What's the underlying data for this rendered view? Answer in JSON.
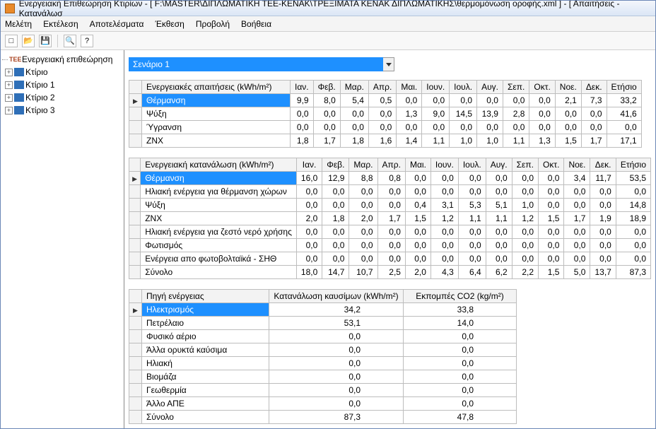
{
  "window_title": "Ενεργειακή Επιθεώρηση Κτιρίων - [ F:\\MASTER\\ΔΙΠΛΩΜΑΤΙΚΗ ΤΕΕ-ΚΕΝΑΚ\\ΤΡΕΞΙΜΑΤΑ ΚΕΝΑΚ ΔΙΠΛΩΜΑΤΙΚΗΣ\\θερμομόνωση οροφής.xml ] - [ Απαιτήσεις - Κατανάλωσ",
  "menu": [
    "Μελέτη",
    "Εκτέλεση",
    "Αποτελέσματα",
    "Έκθεση",
    "Προβολή",
    "Βοήθεια"
  ],
  "toolbar_icons": [
    "new-icon",
    "open-icon",
    "save-icon",
    "preview-icon",
    "help-icon"
  ],
  "tree": {
    "root": "Ενεργειακή επιθεώρηση",
    "children": [
      "Κτίριο",
      "Κτίριο 1",
      "Κτίριο 2",
      "Κτίριο 3"
    ]
  },
  "scenario": "Σενάριο 1",
  "months": [
    "Ιαν.",
    "Φεβ.",
    "Μαρ.",
    "Απρ.",
    "Μαι.",
    "Ιουν.",
    "Ιουλ.",
    "Αυγ.",
    "Σεπ.",
    "Οκτ.",
    "Νοε.",
    "Δεκ.",
    "Ετήσιο"
  ],
  "table1": {
    "title": "Ενεργειακές απαιτήσεις (kWh/m²)",
    "rows": [
      {
        "label": "Θέρμανση",
        "hl": true,
        "v": [
          "9,9",
          "8,0",
          "5,4",
          "0,5",
          "0,0",
          "0,0",
          "0,0",
          "0,0",
          "0,0",
          "0,0",
          "2,1",
          "7,3",
          "33,2"
        ]
      },
      {
        "label": "Ψύξη",
        "v": [
          "0,0",
          "0,0",
          "0,0",
          "0,0",
          "1,3",
          "9,0",
          "14,5",
          "13,9",
          "2,8",
          "0,0",
          "0,0",
          "0,0",
          "41,6"
        ]
      },
      {
        "label": "Ύγρανση",
        "v": [
          "0,0",
          "0,0",
          "0,0",
          "0,0",
          "0,0",
          "0,0",
          "0,0",
          "0,0",
          "0,0",
          "0,0",
          "0,0",
          "0,0",
          "0,0"
        ]
      },
      {
        "label": "ΖΝΧ",
        "v": [
          "1,8",
          "1,7",
          "1,8",
          "1,6",
          "1,4",
          "1,1",
          "1,0",
          "1,0",
          "1,1",
          "1,3",
          "1,5",
          "1,7",
          "17,1"
        ]
      }
    ]
  },
  "table2": {
    "title": "Ενεργειακή κατανάλωση (kWh/m²)",
    "rows": [
      {
        "label": "Θέρμανση",
        "hl": true,
        "v": [
          "16,0",
          "12,9",
          "8,8",
          "0,8",
          "0,0",
          "0,0",
          "0,0",
          "0,0",
          "0,0",
          "0,0",
          "3,4",
          "11,7",
          "53,5"
        ]
      },
      {
        "label": "Ηλιακή ενέργεια για θέρμανση χώρων",
        "v": [
          "0,0",
          "0,0",
          "0,0",
          "0,0",
          "0,0",
          "0,0",
          "0,0",
          "0,0",
          "0,0",
          "0,0",
          "0,0",
          "0,0",
          "0,0"
        ]
      },
      {
        "label": "Ψύξη",
        "v": [
          "0,0",
          "0,0",
          "0,0",
          "0,0",
          "0,4",
          "3,1",
          "5,3",
          "5,1",
          "1,0",
          "0,0",
          "0,0",
          "0,0",
          "14,8"
        ]
      },
      {
        "label": "ΖΝΧ",
        "v": [
          "2,0",
          "1,8",
          "2,0",
          "1,7",
          "1,5",
          "1,2",
          "1,1",
          "1,1",
          "1,2",
          "1,5",
          "1,7",
          "1,9",
          "18,9"
        ]
      },
      {
        "label": "Ηλιακή ενέργεια για ζεστό νερό χρήσης",
        "v": [
          "0,0",
          "0,0",
          "0,0",
          "0,0",
          "0,0",
          "0,0",
          "0,0",
          "0,0",
          "0,0",
          "0,0",
          "0,0",
          "0,0",
          "0,0"
        ]
      },
      {
        "label": "Φωτισμός",
        "v": [
          "0,0",
          "0,0",
          "0,0",
          "0,0",
          "0,0",
          "0,0",
          "0,0",
          "0,0",
          "0,0",
          "0,0",
          "0,0",
          "0,0",
          "0,0"
        ]
      },
      {
        "label": "Ενέργεια απο φωτοβολταϊκά - ΣΗΘ",
        "v": [
          "0,0",
          "0,0",
          "0,0",
          "0,0",
          "0,0",
          "0,0",
          "0,0",
          "0,0",
          "0,0",
          "0,0",
          "0,0",
          "0,0",
          "0,0"
        ]
      },
      {
        "label": "Σύνολο",
        "v": [
          "18,0",
          "14,7",
          "10,7",
          "2,5",
          "2,0",
          "4,3",
          "6,4",
          "6,2",
          "2,2",
          "1,5",
          "5,0",
          "13,7",
          "87,3"
        ]
      }
    ]
  },
  "table3": {
    "headers": [
      "Πηγή ενέργειας",
      "Κατανάλωση καυσίμων (kWh/m²)",
      "Εκπομπές CO2 (kg/m²)"
    ],
    "rows": [
      {
        "label": "Ηλεκτρισμός",
        "hl": true,
        "v": [
          "34,2",
          "33,8"
        ]
      },
      {
        "label": "Πετρέλαιο",
        "v": [
          "53,1",
          "14,0"
        ]
      },
      {
        "label": "Φυσικό αέριο",
        "v": [
          "0,0",
          "0,0"
        ]
      },
      {
        "label": "Άλλα ορυκτά καύσιμα",
        "v": [
          "0,0",
          "0,0"
        ]
      },
      {
        "label": "Ηλιακή",
        "v": [
          "0,0",
          "0,0"
        ]
      },
      {
        "label": "Βιομάζα",
        "v": [
          "0,0",
          "0,0"
        ]
      },
      {
        "label": "Γεωθερμία",
        "v": [
          "0,0",
          "0,0"
        ]
      },
      {
        "label": "Άλλο ΑΠΕ",
        "v": [
          "0,0",
          "0,0"
        ]
      },
      {
        "label": "Σύνολο",
        "v": [
          "87,3",
          "47,8"
        ]
      }
    ]
  }
}
